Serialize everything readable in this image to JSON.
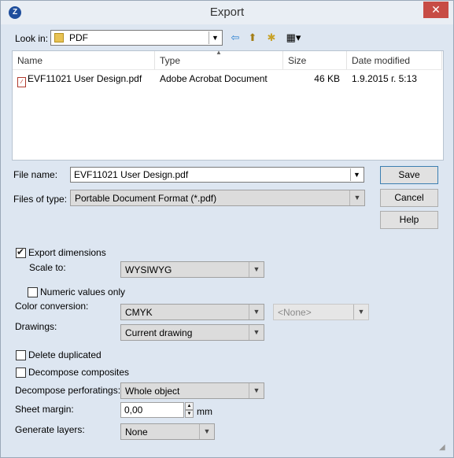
{
  "window": {
    "title": "Export",
    "close_glyph": "✕"
  },
  "look_in": {
    "label": "Look in:",
    "value": "PDF"
  },
  "file_list": {
    "columns": [
      "Name",
      "Type",
      "Size",
      "Date modified"
    ],
    "rows": [
      {
        "name": "EVF11021 User Design.pdf",
        "type": "Adobe Acrobat Document",
        "size": "46 KB",
        "date": "1.9.2015 г. 5:13"
      }
    ]
  },
  "file_name": {
    "label": "File name:",
    "value": "EVF11021 User Design.pdf"
  },
  "files_of_type": {
    "label": "Files of type:",
    "value": "Portable Document Format (*.pdf)"
  },
  "buttons": {
    "save": "Save",
    "cancel": "Cancel",
    "help": "Help"
  },
  "options": {
    "export_dimensions": {
      "label": "Export dimensions",
      "checked": true
    },
    "scale_to": {
      "label": "Scale to:",
      "value": "WYSIWYG"
    },
    "numeric_values_only": {
      "label": "Numeric values only",
      "checked": false
    },
    "color_conversion": {
      "label": "Color conversion:",
      "value": "CMYK",
      "secondary": "<None>"
    },
    "drawings": {
      "label": "Drawings:",
      "value": "Current drawing"
    },
    "delete_duplicated": {
      "label": "Delete duplicated",
      "checked": false
    },
    "decompose_composites": {
      "label": "Decompose composites",
      "checked": false
    },
    "decompose_perforatings": {
      "label": "Decompose perforatings:",
      "value": "Whole object"
    },
    "sheet_margin": {
      "label": "Sheet margin:",
      "value": "0,00",
      "unit": "mm"
    },
    "generate_layers": {
      "label": "Generate layers:",
      "value": "None"
    }
  },
  "icons": {
    "app": "app-logo-icon",
    "back": "back-arrow-icon",
    "up": "up-folder-icon",
    "new_folder": "new-folder-icon",
    "view": "view-menu-icon"
  },
  "colors": {
    "background": "#dde6f1",
    "close": "#c74c45"
  }
}
